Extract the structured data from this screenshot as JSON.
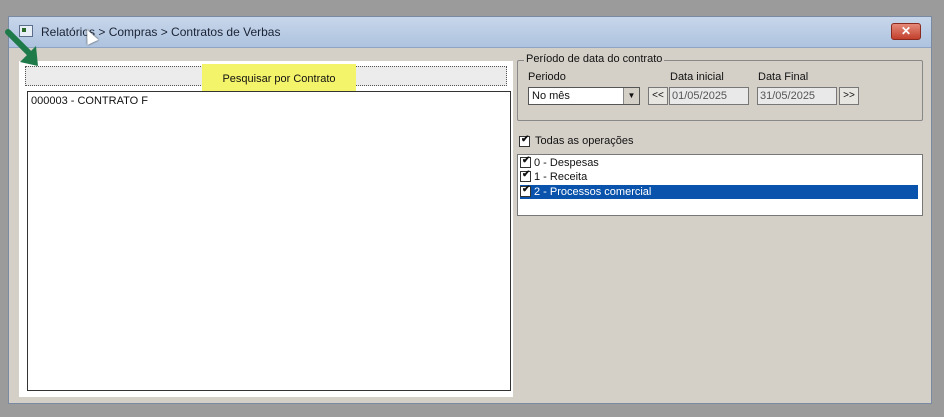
{
  "window": {
    "title": "Relatórios > Compras > Contratos de Verbas",
    "close_label": "✕"
  },
  "search": {
    "button_label": "Pesquisar por Contrato",
    "results": [
      "000003 - CONTRATO F"
    ]
  },
  "period": {
    "group_title": "Período de data do contrato",
    "periodo_label": "Periodo",
    "periodo_value": "No mês",
    "prev_label": "<<",
    "next_label": ">>",
    "start_label": "Data inicial",
    "start_value": "01/05/2025",
    "end_label": "Data Final",
    "end_value": "31/05/2025"
  },
  "operations": {
    "all_label": "Todas as operações",
    "all_checked": true,
    "items": [
      {
        "label": "0 - Despesas",
        "checked": true,
        "selected": false
      },
      {
        "label": "1 - Receita",
        "checked": true,
        "selected": false
      },
      {
        "label": "2 - Processos comercial",
        "checked": true,
        "selected": true
      }
    ]
  },
  "colors": {
    "highlight": "#f4f46a",
    "selection": "#0a53ac",
    "arrow": "#1f7a4a"
  }
}
